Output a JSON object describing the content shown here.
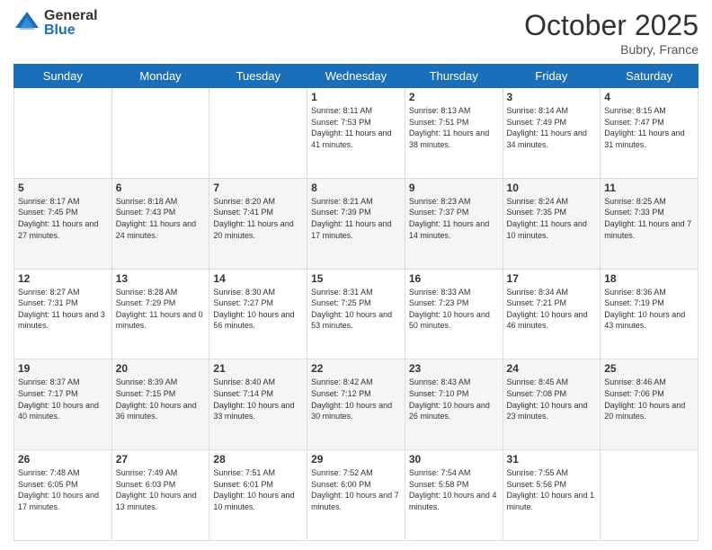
{
  "header": {
    "logo_general": "General",
    "logo_blue": "Blue",
    "month_title": "October 2025",
    "location": "Bubry, France"
  },
  "days_of_week": [
    "Sunday",
    "Monday",
    "Tuesday",
    "Wednesday",
    "Thursday",
    "Friday",
    "Saturday"
  ],
  "weeks": [
    [
      {
        "day": "",
        "info": ""
      },
      {
        "day": "",
        "info": ""
      },
      {
        "day": "",
        "info": ""
      },
      {
        "day": "1",
        "info": "Sunrise: 8:11 AM\nSunset: 7:53 PM\nDaylight: 11 hours and 41 minutes."
      },
      {
        "day": "2",
        "info": "Sunrise: 8:13 AM\nSunset: 7:51 PM\nDaylight: 11 hours and 38 minutes."
      },
      {
        "day": "3",
        "info": "Sunrise: 8:14 AM\nSunset: 7:49 PM\nDaylight: 11 hours and 34 minutes."
      },
      {
        "day": "4",
        "info": "Sunrise: 8:15 AM\nSunset: 7:47 PM\nDaylight: 11 hours and 31 minutes."
      }
    ],
    [
      {
        "day": "5",
        "info": "Sunrise: 8:17 AM\nSunset: 7:45 PM\nDaylight: 11 hours and 27 minutes."
      },
      {
        "day": "6",
        "info": "Sunrise: 8:18 AM\nSunset: 7:43 PM\nDaylight: 11 hours and 24 minutes."
      },
      {
        "day": "7",
        "info": "Sunrise: 8:20 AM\nSunset: 7:41 PM\nDaylight: 11 hours and 20 minutes."
      },
      {
        "day": "8",
        "info": "Sunrise: 8:21 AM\nSunset: 7:39 PM\nDaylight: 11 hours and 17 minutes."
      },
      {
        "day": "9",
        "info": "Sunrise: 8:23 AM\nSunset: 7:37 PM\nDaylight: 11 hours and 14 minutes."
      },
      {
        "day": "10",
        "info": "Sunrise: 8:24 AM\nSunset: 7:35 PM\nDaylight: 11 hours and 10 minutes."
      },
      {
        "day": "11",
        "info": "Sunrise: 8:25 AM\nSunset: 7:33 PM\nDaylight: 11 hours and 7 minutes."
      }
    ],
    [
      {
        "day": "12",
        "info": "Sunrise: 8:27 AM\nSunset: 7:31 PM\nDaylight: 11 hours and 3 minutes."
      },
      {
        "day": "13",
        "info": "Sunrise: 8:28 AM\nSunset: 7:29 PM\nDaylight: 11 hours and 0 minutes."
      },
      {
        "day": "14",
        "info": "Sunrise: 8:30 AM\nSunset: 7:27 PM\nDaylight: 10 hours and 56 minutes."
      },
      {
        "day": "15",
        "info": "Sunrise: 8:31 AM\nSunset: 7:25 PM\nDaylight: 10 hours and 53 minutes."
      },
      {
        "day": "16",
        "info": "Sunrise: 8:33 AM\nSunset: 7:23 PM\nDaylight: 10 hours and 50 minutes."
      },
      {
        "day": "17",
        "info": "Sunrise: 8:34 AM\nSunset: 7:21 PM\nDaylight: 10 hours and 46 minutes."
      },
      {
        "day": "18",
        "info": "Sunrise: 8:36 AM\nSunset: 7:19 PM\nDaylight: 10 hours and 43 minutes."
      }
    ],
    [
      {
        "day": "19",
        "info": "Sunrise: 8:37 AM\nSunset: 7:17 PM\nDaylight: 10 hours and 40 minutes."
      },
      {
        "day": "20",
        "info": "Sunrise: 8:39 AM\nSunset: 7:15 PM\nDaylight: 10 hours and 36 minutes."
      },
      {
        "day": "21",
        "info": "Sunrise: 8:40 AM\nSunset: 7:14 PM\nDaylight: 10 hours and 33 minutes."
      },
      {
        "day": "22",
        "info": "Sunrise: 8:42 AM\nSunset: 7:12 PM\nDaylight: 10 hours and 30 minutes."
      },
      {
        "day": "23",
        "info": "Sunrise: 8:43 AM\nSunset: 7:10 PM\nDaylight: 10 hours and 26 minutes."
      },
      {
        "day": "24",
        "info": "Sunrise: 8:45 AM\nSunset: 7:08 PM\nDaylight: 10 hours and 23 minutes."
      },
      {
        "day": "25",
        "info": "Sunrise: 8:46 AM\nSunset: 7:06 PM\nDaylight: 10 hours and 20 minutes."
      }
    ],
    [
      {
        "day": "26",
        "info": "Sunrise: 7:48 AM\nSunset: 6:05 PM\nDaylight: 10 hours and 17 minutes."
      },
      {
        "day": "27",
        "info": "Sunrise: 7:49 AM\nSunset: 6:03 PM\nDaylight: 10 hours and 13 minutes."
      },
      {
        "day": "28",
        "info": "Sunrise: 7:51 AM\nSunset: 6:01 PM\nDaylight: 10 hours and 10 minutes."
      },
      {
        "day": "29",
        "info": "Sunrise: 7:52 AM\nSunset: 6:00 PM\nDaylight: 10 hours and 7 minutes."
      },
      {
        "day": "30",
        "info": "Sunrise: 7:54 AM\nSunset: 5:58 PM\nDaylight: 10 hours and 4 minutes."
      },
      {
        "day": "31",
        "info": "Sunrise: 7:55 AM\nSunset: 5:56 PM\nDaylight: 10 hours and 1 minute."
      },
      {
        "day": "",
        "info": ""
      }
    ]
  ]
}
